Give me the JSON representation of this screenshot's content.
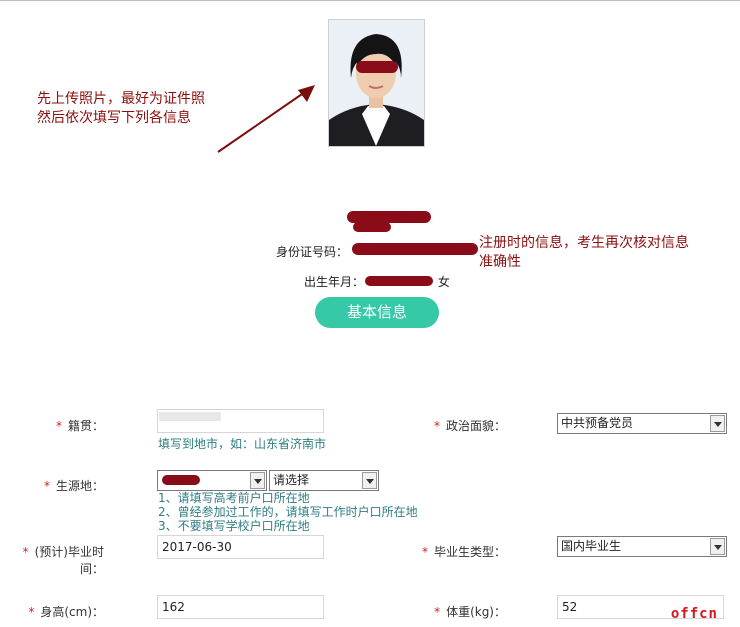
{
  "annotations": {
    "upload_line1": "先上传照片，最好为证件照",
    "upload_line2": "然后依次填写下列各信息",
    "verify_line1": "注册时的信息，考生再次核对信息",
    "verify_line2": "准确性"
  },
  "profile": {
    "name": "",
    "id_label": "身份证号码：",
    "id_value": "",
    "birth_label": "出生年月：",
    "birth_value": "",
    "gender": "女"
  },
  "basic_info_button": "基本信息",
  "form": {
    "native_place": {
      "label": "籍贯：",
      "value": "",
      "hint": "填写到地市，如：山东省济南市"
    },
    "political_status": {
      "label": "政治面貌：",
      "value": "中共预备党员"
    },
    "origin": {
      "label": "生源地：",
      "select1_value": "",
      "select2_value": "请选择",
      "hints": [
        "1、请填写高考前户口所在地",
        "2、曾经参加过工作的，请填写工作时户口所在地",
        "3、不要填写学校户口所在地"
      ]
    },
    "graduation_time": {
      "label": "(预计)毕业时间：",
      "value": "2017-06-30"
    },
    "graduate_type": {
      "label": "毕业生类型：",
      "value": "国内毕业生"
    },
    "height": {
      "label": "身高(cm)：",
      "value": "162"
    },
    "weight": {
      "label": "体重(kg)：",
      "value": "52"
    }
  },
  "required_mark": "*",
  "watermark": "offcn",
  "colors": {
    "accent_button": "#35c9a8",
    "annotation": "#8b0f0f",
    "hint": "#2e7d82",
    "required": "#d32020"
  }
}
